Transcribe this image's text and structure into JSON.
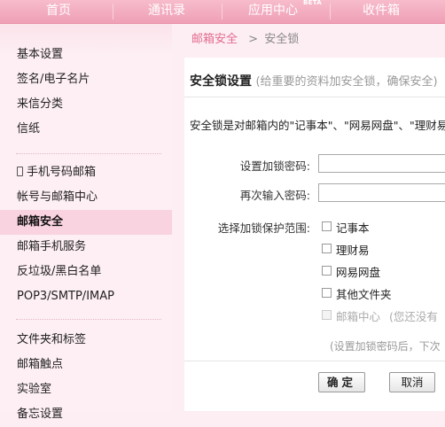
{
  "topnav": {
    "tabs": [
      "首页",
      "通讯录",
      "应用中心",
      "收件箱"
    ],
    "beta": "BETA"
  },
  "sidebar": {
    "group1": [
      "基本设置",
      "签名/电子名片",
      "来信分类",
      "信纸"
    ],
    "group2": [
      "手机号码邮箱",
      "帐号与邮箱中心",
      "邮箱安全",
      "邮箱手机服务",
      "反垃圾/黑白名单",
      "POP3/SMTP/IMAP"
    ],
    "group3": [
      "文件夹和标签",
      "邮箱触点",
      "实验室",
      "备忘设置"
    ]
  },
  "breadcrumb": {
    "parent": "邮箱安全",
    "sep": ">",
    "current": "安全锁"
  },
  "panel": {
    "title": "安全锁设置",
    "subtitle": "(给重要的资料加安全锁，确保安全)",
    "description": "安全锁是对邮箱内的\"记事本\"、\"网易网盘\"、\"理财易\"",
    "password_label": "设置加锁密码:",
    "confirm_label": "再次输入密码:",
    "scope_label": "选择加锁保护范围:",
    "scope_options": [
      "记事本",
      "理财易",
      "网易网盘",
      "其他文件夹"
    ],
    "disabled_option": "邮箱中心",
    "disabled_note": "(您还没有",
    "hint": "(设置加锁密码后，下次",
    "ok_label": "确定",
    "cancel_label": "取消"
  }
}
